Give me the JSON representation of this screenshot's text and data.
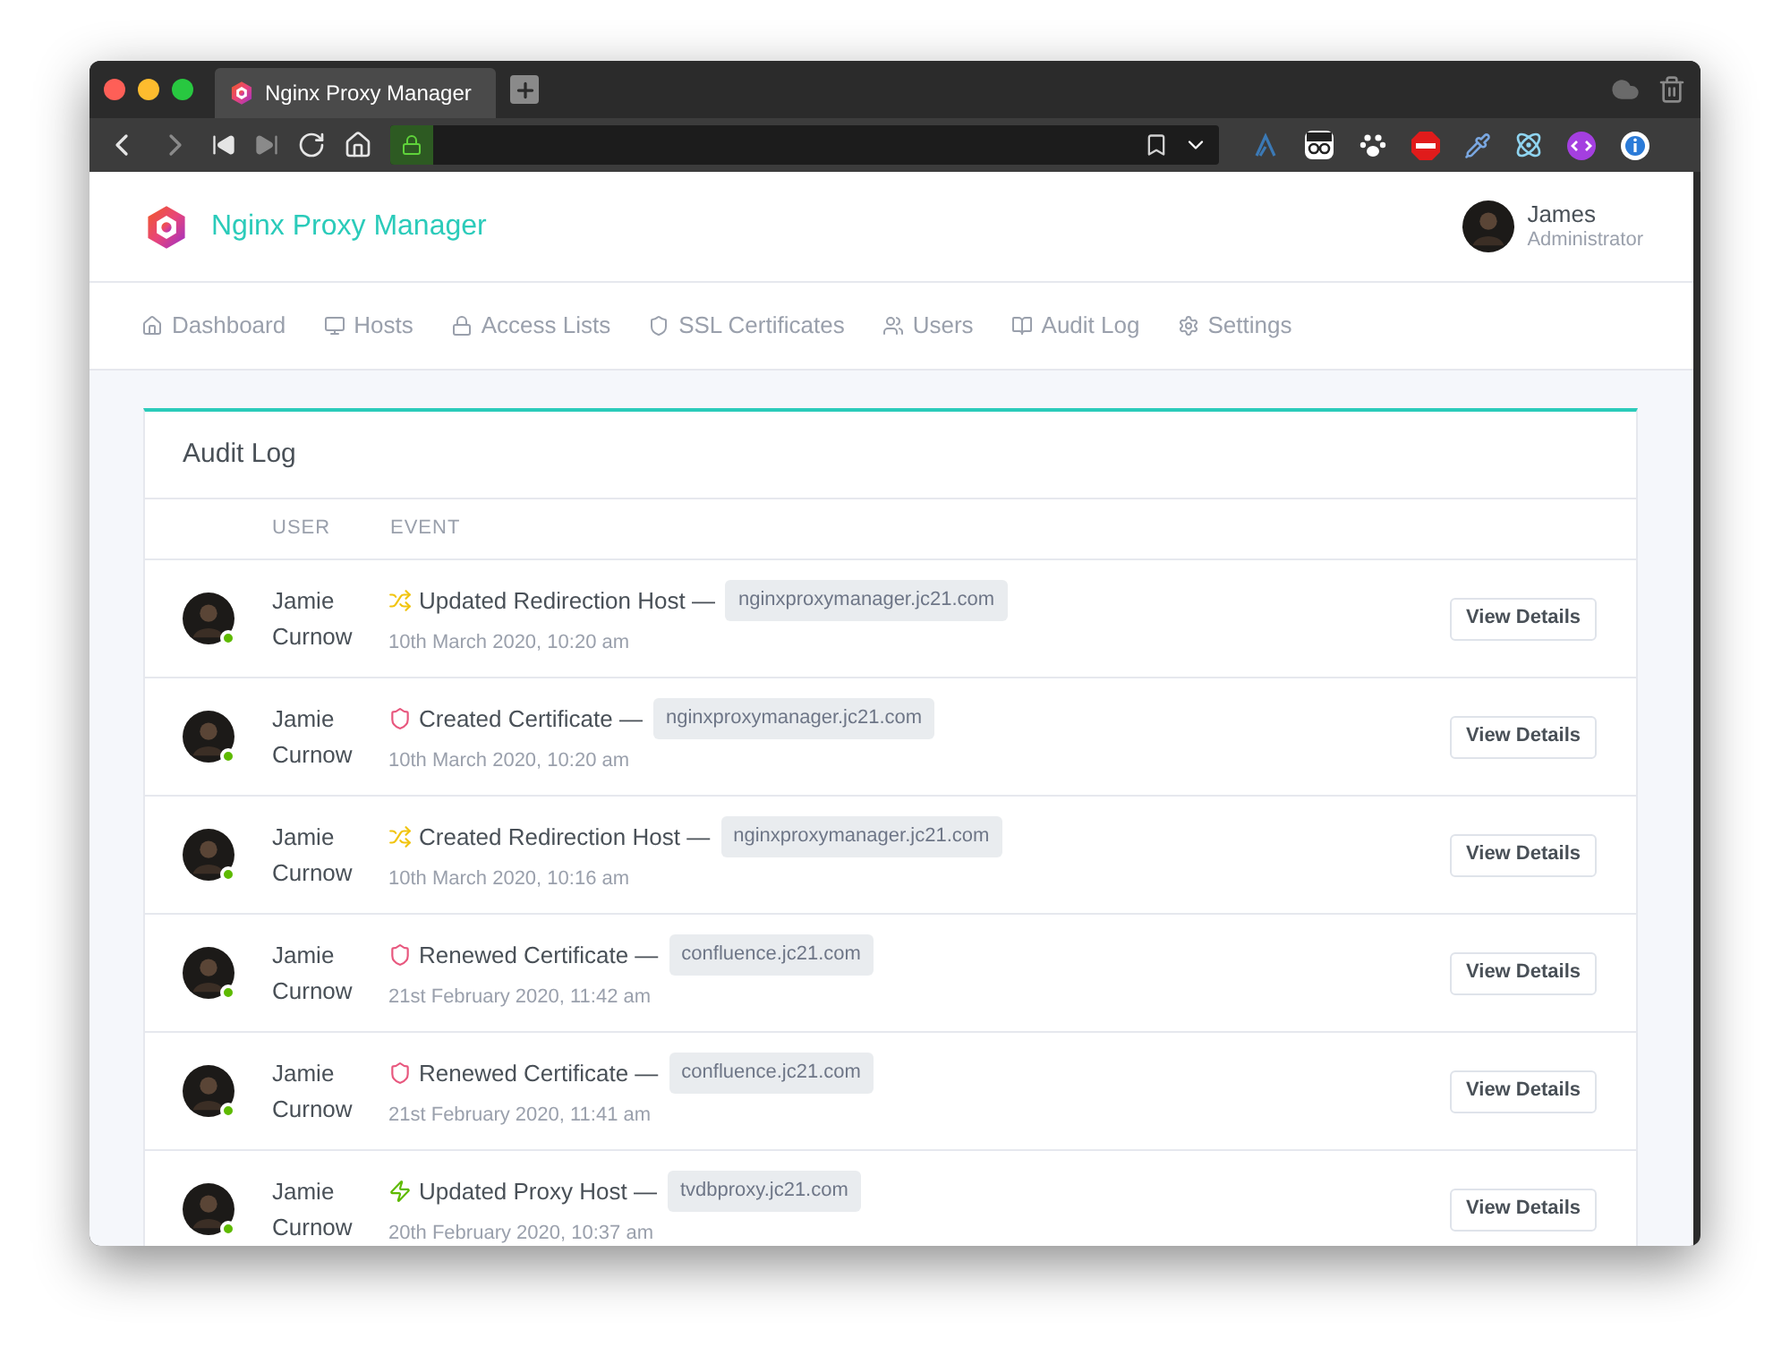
{
  "browser": {
    "tab_title": "Nginx Proxy Manager"
  },
  "header": {
    "brand": "Nginx Proxy Manager",
    "user_name": "James",
    "user_role": "Administrator"
  },
  "nav": [
    {
      "label": "Dashboard",
      "kind": "home"
    },
    {
      "label": "Hosts",
      "kind": "monitor"
    },
    {
      "label": "Access Lists",
      "kind": "lock"
    },
    {
      "label": "SSL Certificates",
      "kind": "shield"
    },
    {
      "label": "Users",
      "kind": "users"
    },
    {
      "label": "Audit Log",
      "kind": "book"
    },
    {
      "label": "Settings",
      "kind": "settings"
    }
  ],
  "card": {
    "title": "Audit Log",
    "columns": [
      "USER",
      "EVENT"
    ],
    "rows": [
      {
        "user_first": "Jamie",
        "user_last": "Curnow",
        "online": true,
        "kind": "redirection",
        "event": "Updated Redirection Host —",
        "host": "nginxproxymanager.jc21.com",
        "time": "10th March 2020, 10:20 am",
        "button": "View Details"
      },
      {
        "user_first": "Jamie",
        "user_last": "Curnow",
        "online": true,
        "kind": "certificate",
        "event": "Created Certificate —",
        "host": "nginxproxymanager.jc21.com",
        "time": "10th March 2020, 10:20 am",
        "button": "View Details"
      },
      {
        "user_first": "Jamie",
        "user_last": "Curnow",
        "online": true,
        "kind": "redirection",
        "event": "Created Redirection Host —",
        "host": "nginxproxymanager.jc21.com",
        "time": "10th March 2020, 10:16 am",
        "button": "View Details"
      },
      {
        "user_first": "Jamie",
        "user_last": "Curnow",
        "online": true,
        "kind": "certificate",
        "event": "Renewed Certificate —",
        "host": "confluence.jc21.com",
        "time": "21st February 2020, 11:42 am",
        "button": "View Details"
      },
      {
        "user_first": "Jamie",
        "user_last": "Curnow",
        "online": true,
        "kind": "certificate",
        "event": "Renewed Certificate —",
        "host": "confluence.jc21.com",
        "time": "21st February 2020, 11:41 am",
        "button": "View Details"
      },
      {
        "user_first": "Jamie",
        "user_last": "Curnow",
        "online": true,
        "kind": "proxy",
        "event": "Updated Proxy Host —",
        "host": "tvdbproxy.jc21.com",
        "time": "20th February 2020, 10:37 am",
        "button": "View Details"
      }
    ]
  }
}
